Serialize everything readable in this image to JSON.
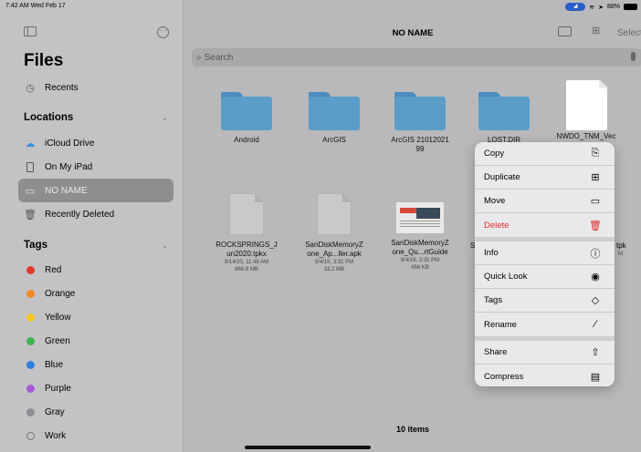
{
  "status": {
    "time": "7:42 AM  Wed Feb 17",
    "battery": "88%"
  },
  "sidebar": {
    "title": "Files",
    "recents": "Recents",
    "locations_header": "Locations",
    "locations": [
      "iCloud Drive",
      "On My iPad",
      "NO NAME",
      "Recently Deleted"
    ],
    "selected_location": "NO NAME",
    "tags_header": "Tags",
    "tags": [
      {
        "label": "Red",
        "color": "#e03a30"
      },
      {
        "label": "Orange",
        "color": "#f0892b"
      },
      {
        "label": "Yellow",
        "color": "#f2c427"
      },
      {
        "label": "Green",
        "color": "#3cb44b"
      },
      {
        "label": "Blue",
        "color": "#2f7ee0"
      },
      {
        "label": "Purple",
        "color": "#a65bd6"
      },
      {
        "label": "Gray",
        "color": "#8e8e93"
      },
      {
        "label": "Work",
        "color": ""
      }
    ]
  },
  "main": {
    "title": "NO NAME",
    "select_label": "Select",
    "search_placeholder": "Search",
    "items": [
      {
        "name": "Android",
        "meta": "",
        "kind": "folder"
      },
      {
        "name": "ArcGIS",
        "meta": "",
        "kind": "folder"
      },
      {
        "name": "ArcGIS 21012021\n99",
        "meta": "",
        "kind": "folder"
      },
      {
        "name": "LOST.DIR",
        "meta": "",
        "kind": "folder"
      },
      {
        "name": "NWDO_TNM_Vec",
        "meta": "",
        "kind": "doc-white"
      },
      {
        "name": "ROCKSPRINGS_J\nun2020.tpkx",
        "meta": "9/14/20, 11:48 AM\n868.8 MB",
        "kind": "doc"
      },
      {
        "name": "SanDiskMemoryZ\none_Ap...ller.apk",
        "meta": "9/4/19, 3:31 PM\n33.2 MB",
        "kind": "doc"
      },
      {
        "name": "SanDiskMemoryZ\none_Qu...rtGuide",
        "meta": "9/4/19, 3:31 PM\n456 KB",
        "kind": "thumb"
      }
    ],
    "partial_labels": {
      "pk": "pk",
      "tpk": "tpk",
      "s": "S",
      "m": "M"
    },
    "item_count": "10 items"
  },
  "menu": {
    "group1": [
      {
        "label": "Copy",
        "icon": "copy-icon",
        "glyph": "⎘"
      },
      {
        "label": "Duplicate",
        "icon": "duplicate-icon",
        "glyph": "⊞"
      },
      {
        "label": "Move",
        "icon": "folder-icon",
        "glyph": "▭"
      },
      {
        "label": "Delete",
        "icon": "trash-icon",
        "glyph": "🗑"
      }
    ],
    "group2": [
      {
        "label": "Info",
        "icon": "info-icon",
        "glyph": "ⓘ"
      },
      {
        "label": "Quick Look",
        "icon": "eye-icon",
        "glyph": "◉"
      },
      {
        "label": "Tags",
        "icon": "tag-icon",
        "glyph": "◇"
      },
      {
        "label": "Rename",
        "icon": "pencil-icon",
        "glyph": "∕"
      }
    ],
    "group3": [
      {
        "label": "Share",
        "icon": "share-icon",
        "glyph": "⇧"
      },
      {
        "label": "Compress",
        "icon": "archive-icon",
        "glyph": "▤"
      }
    ]
  }
}
